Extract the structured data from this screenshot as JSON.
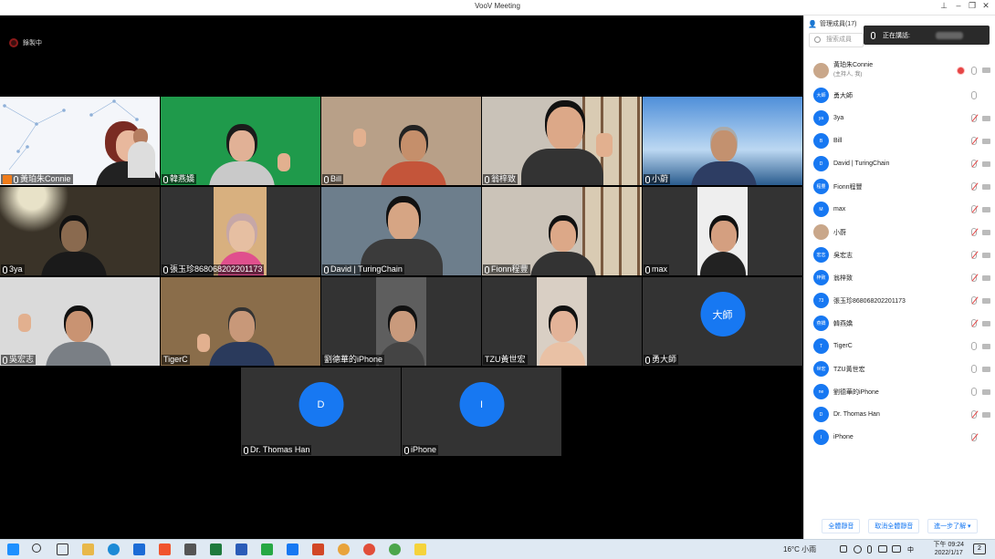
{
  "window": {
    "title": "VooV Meeting"
  },
  "recording": {
    "label": "錄製中"
  },
  "speaking": {
    "label": "正在講話:"
  },
  "panel": {
    "header": "管理成員(17)",
    "search_placeholder": "搜索成員",
    "members": [
      {
        "name": "黃珀朱Connie",
        "sub": "(主持人, 我)",
        "avatar": "",
        "muted": false,
        "recording": true
      },
      {
        "name": "勇大師",
        "avatar": "大師",
        "muted": false
      },
      {
        "name": "3ya",
        "avatar": "ya",
        "muted": true
      },
      {
        "name": "Bill",
        "avatar": "B",
        "muted": true
      },
      {
        "name": "David | TuringChain",
        "avatar": "D",
        "muted": true
      },
      {
        "name": "Fionn程豐",
        "avatar": "程豐",
        "muted": true
      },
      {
        "name": "max",
        "avatar": "M",
        "muted": true
      },
      {
        "name": "小蔚",
        "avatar": "",
        "muted": true
      },
      {
        "name": "吳宏志",
        "avatar": "宏志",
        "muted": true
      },
      {
        "name": "翁梓致",
        "avatar": "梓致",
        "muted": true
      },
      {
        "name": "張玉珍868068202201173",
        "avatar": "73",
        "muted": true
      },
      {
        "name": "韓燕嬌",
        "avatar": "燕嬌",
        "muted": true
      },
      {
        "name": "TigerC",
        "avatar": "T",
        "muted": false
      },
      {
        "name": "TZU黃世宏",
        "avatar": "世宏",
        "muted": false
      },
      {
        "name": "劉德華的iPhone",
        "avatar": "ne",
        "muted": false
      },
      {
        "name": "Dr. Thomas Han",
        "avatar": "D",
        "muted": true
      },
      {
        "name": "iPhone",
        "avatar": "I",
        "muted": true
      }
    ],
    "buttons": [
      "全體靜音",
      "取消全體靜音",
      "進一步了解 ▾"
    ]
  },
  "tiles": [
    {
      "label": "黃珀朱Connie",
      "host": true
    },
    {
      "label": "韓燕嬌"
    },
    {
      "label": "Bill"
    },
    {
      "label": "翁梓致"
    },
    {
      "label": "小蔚"
    },
    {
      "label": "3ya"
    },
    {
      "label": "張玉珍868068202201173"
    },
    {
      "label": "David | TuringChain"
    },
    {
      "label": "Fionn程豐"
    },
    {
      "label": "max"
    },
    {
      "label": "吳宏志"
    },
    {
      "label": "TigerC"
    },
    {
      "label": "劉德華的iPhone"
    },
    {
      "label": "TZU黃世宏"
    },
    {
      "label": "勇大師",
      "avatar": "大師"
    },
    {
      "label": "Dr. Thomas Han",
      "avatar": "D"
    },
    {
      "label": "iPhone",
      "avatar": "I"
    }
  ],
  "taskbar": {
    "weather": "16°C 小雨",
    "time": "下午 09:24",
    "date": "2022/1/17",
    "notif": "2"
  }
}
